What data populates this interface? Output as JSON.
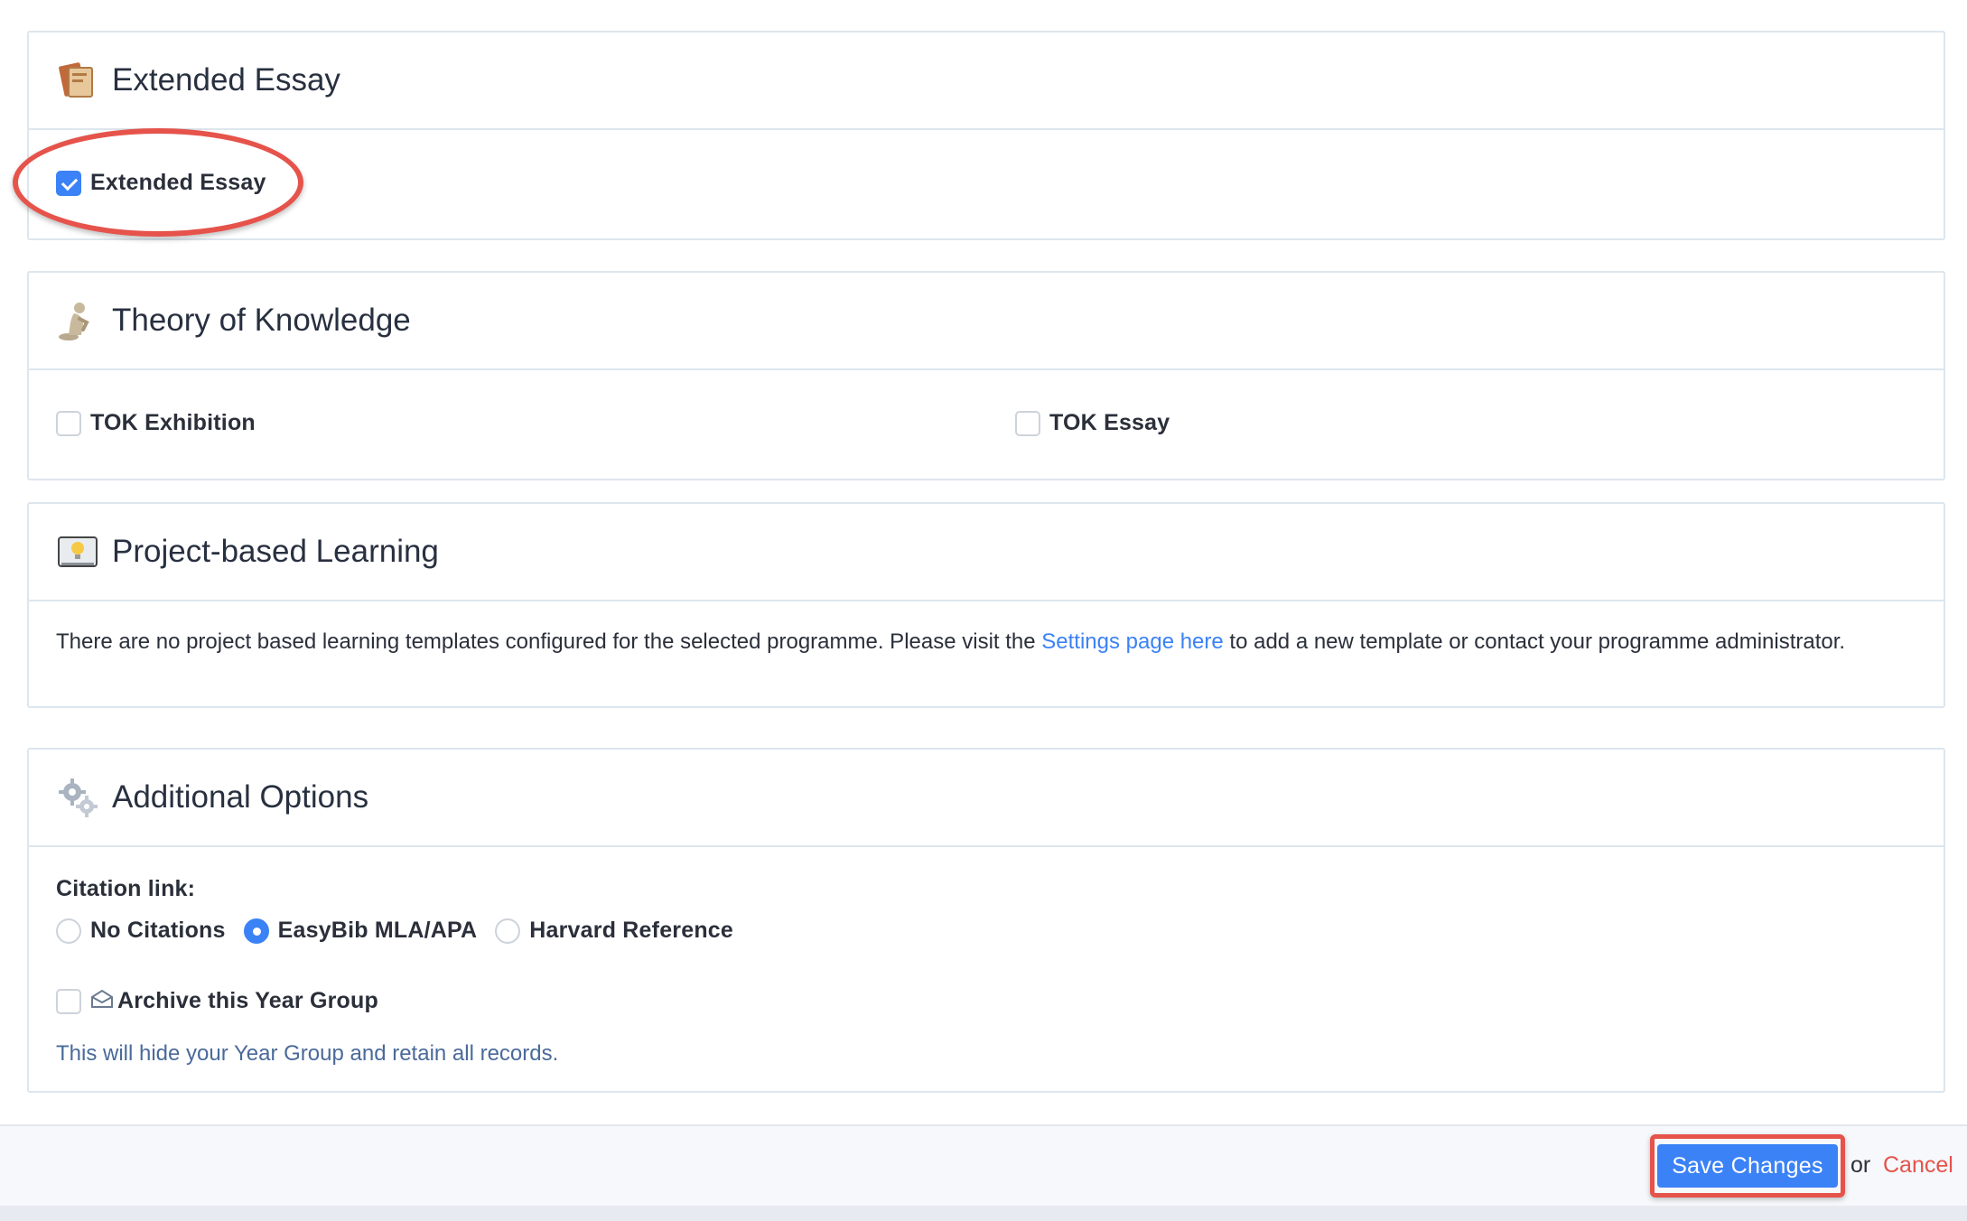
{
  "extended_essay": {
    "title": "Extended Essay",
    "checkbox_label": "Extended Essay",
    "checked": true
  },
  "tok": {
    "title": "Theory of Knowledge",
    "exhibition_label": "TOK Exhibition",
    "essay_label": "TOK Essay"
  },
  "pbl": {
    "title": "Project-based Learning",
    "message_before": "There are no project based learning templates configured for the selected programme. Please visit the ",
    "link_text": "Settings page here",
    "message_after": " to add a new template or contact your programme administrator."
  },
  "additional": {
    "title": "Additional Options",
    "citation_label": "Citation link:",
    "citation_options": [
      "No Citations",
      "EasyBib MLA/APA",
      "Harvard Reference"
    ],
    "citation_selected": "EasyBib MLA/APA",
    "archive_label": "Archive this Year Group",
    "archive_help": "This will hide your Year Group and retain all records."
  },
  "footer": {
    "save_label": "Save Changes",
    "or_text": "or",
    "cancel_label": "Cancel"
  },
  "colors": {
    "accent": "#3b82f6",
    "highlight": "#e5534b",
    "border": "#dde6ee"
  }
}
